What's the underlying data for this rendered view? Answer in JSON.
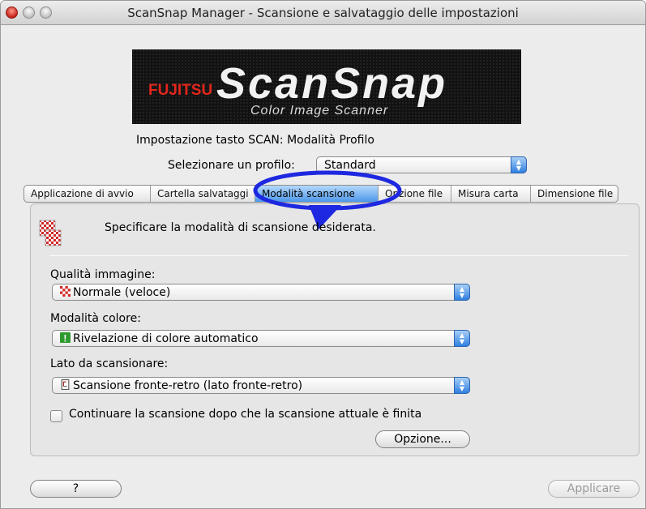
{
  "window": {
    "title": "ScanSnap Manager - Scansione e salvataggio delle impostazioni"
  },
  "logo": {
    "brand": "FUJITSU",
    "product": "ScanSnap",
    "tagline": "Color Image Scanner"
  },
  "header": {
    "profile_line": "Impostazione tasto SCAN: Modalità Profilo",
    "select_label": "Selezionare un profilo:",
    "profile_value": "Standard"
  },
  "tabs": [
    {
      "label": "Applicazione di avvio",
      "active": false
    },
    {
      "label": "Cartella salvataggi",
      "active": false
    },
    {
      "label": "Modalità scansione",
      "active": true
    },
    {
      "label": "Opzione file",
      "active": false
    },
    {
      "label": "Misura carta",
      "active": false
    },
    {
      "label": "Dimensione file",
      "active": false
    }
  ],
  "panel": {
    "description": "Specificare la modalità di scansione desiderata.",
    "image_quality": {
      "label": "Qualità immagine:",
      "value": "Normale (veloce)",
      "icon": "checker-icon"
    },
    "color_mode": {
      "label": "Modalità colore:",
      "value": "Rivelazione di colore automatico",
      "icon": "exclamation-icon"
    },
    "scan_side": {
      "label": "Lato da scansionare:",
      "value": "Scansione fronte-retro (lato fronte-retro)",
      "icon": "duplex-page-icon"
    },
    "continue_checkbox": {
      "label": "Continuare la scansione dopo che la scansione attuale è finita",
      "checked": false
    },
    "option_button": "Opzione..."
  },
  "footer": {
    "help_button": "?",
    "apply_button": "Applicare"
  },
  "colors": {
    "accent_blue": "#2f7fe0",
    "annotation_ellipse": "#1e28e0",
    "window_bg": "#ececec"
  }
}
